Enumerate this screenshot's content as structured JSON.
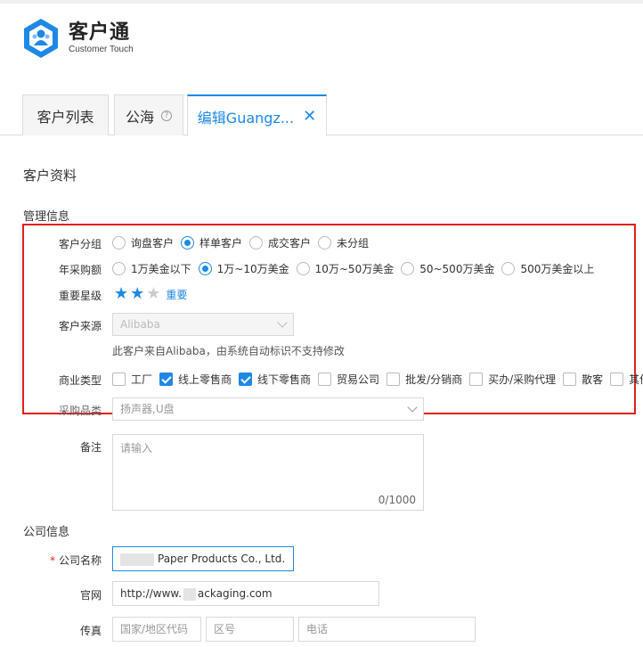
{
  "brand": {
    "title": "客户通",
    "subtitle": "Customer Touch"
  },
  "tabs": [
    {
      "label": "客户列表"
    },
    {
      "label": "公海"
    },
    {
      "label": "编辑Guangz..."
    }
  ],
  "page_title": "客户资料",
  "management": {
    "heading": "管理信息",
    "group": {
      "label": "客户分组",
      "options": [
        "询盘客户",
        "样单客户",
        "成交客户",
        "未分组"
      ],
      "selected": "样单客户"
    },
    "purchase": {
      "label": "年采购额",
      "options": [
        "1万美金以下",
        "1万~10万美金",
        "10万~50万美金",
        "50~500万美金",
        "500万美金以上"
      ],
      "selected": "1万~10万美金"
    },
    "stars": {
      "label": "重要星级",
      "value": 2,
      "max": 3,
      "text": "重要"
    },
    "source": {
      "label": "客户来源",
      "value": "Alibaba",
      "hint": "此客户来自Alibaba，由系统自动标识不支持修改"
    },
    "business_type": {
      "label": "商业类型",
      "options": [
        "工厂",
        "线上零售商",
        "线下零售商",
        "贸易公司",
        "批发/分销商",
        "买办/采购代理",
        "散客",
        "其他"
      ],
      "checked": [
        "线上零售商",
        "线下零售商"
      ]
    },
    "category": {
      "label": "采购品类",
      "value": "扬声器,U盘"
    },
    "remark": {
      "label": "备注",
      "placeholder": "请输入",
      "counter": "0/1000"
    }
  },
  "company": {
    "heading": "公司信息",
    "name": {
      "label": "公司名称",
      "required": "*",
      "value_suffix": "Paper Products Co., Ltd."
    },
    "website": {
      "label": "官网",
      "value_prefix": "http://www.",
      "value_suffix": "ackaging.com"
    },
    "fax": {
      "label": "传真",
      "placeholders": [
        "国家/地区代码",
        "区号",
        "电话"
      ]
    }
  },
  "colors": {
    "accent": "#1e88e5",
    "highlight": "#e02020"
  }
}
